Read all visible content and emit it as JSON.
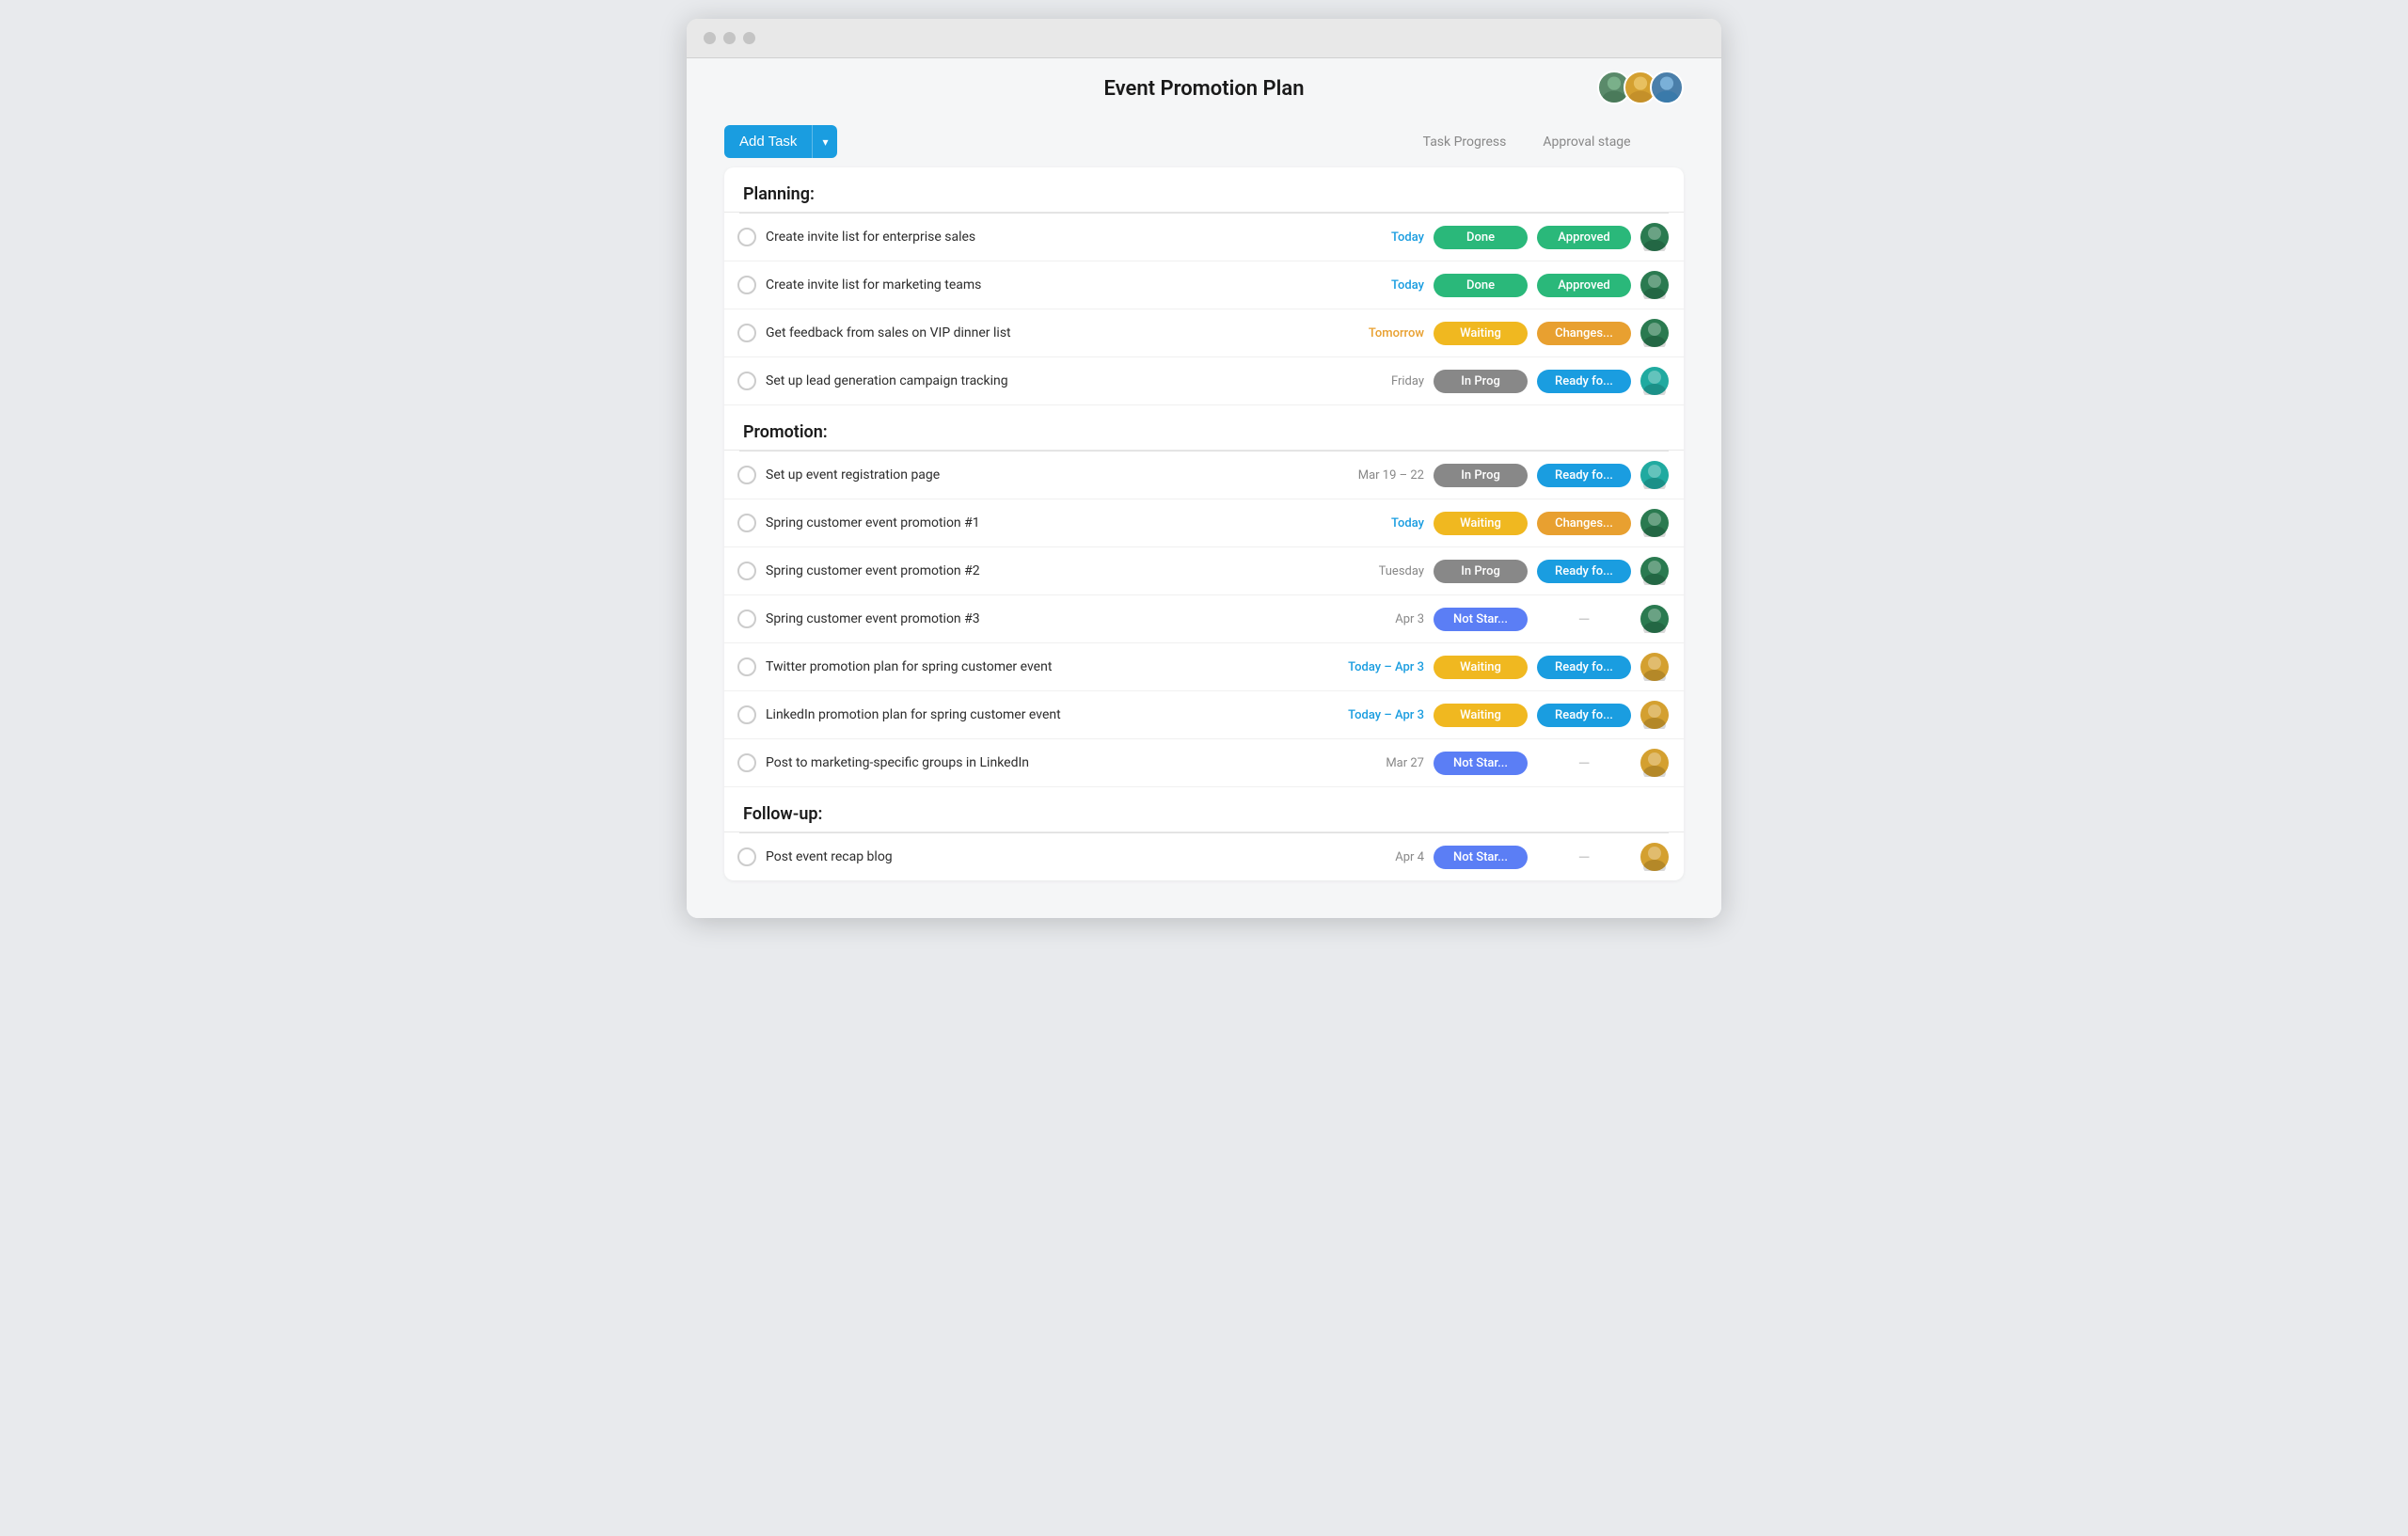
{
  "window": {
    "title": "Event Promotion Plan"
  },
  "header": {
    "title": "Event Promotion Plan",
    "avatars": [
      {
        "id": "av1",
        "class": "avatar-1",
        "label": "U1"
      },
      {
        "id": "av2",
        "class": "avatar-2",
        "label": "U2"
      },
      {
        "id": "av3",
        "class": "avatar-3",
        "label": "U3"
      }
    ]
  },
  "toolbar": {
    "add_task_label": "Add Task",
    "col_headers": [
      "Task Progress",
      "Approval stage"
    ]
  },
  "sections": [
    {
      "id": "planning",
      "title": "Planning:",
      "tasks": [
        {
          "name": "Create invite list for enterprise sales",
          "date": "Today",
          "date_class": "today",
          "progress": "Done",
          "progress_class": "badge-done",
          "approval": "Approved",
          "approval_class": "badge-approved",
          "avatar_class": "av-darkgreen"
        },
        {
          "name": "Create invite list for marketing teams",
          "date": "Today",
          "date_class": "today",
          "progress": "Done",
          "progress_class": "badge-done",
          "approval": "Approved",
          "approval_class": "badge-approved",
          "avatar_class": "av-darkgreen"
        },
        {
          "name": "Get feedback from sales on VIP dinner list",
          "date": "Tomorrow",
          "date_class": "tomorrow",
          "progress": "Waiting",
          "progress_class": "badge-waiting",
          "approval": "Changes...",
          "approval_class": "badge-changes",
          "avatar_class": "av-darkgreen"
        },
        {
          "name": "Set up lead generation campaign tracking",
          "date": "Friday",
          "date_class": "",
          "progress": "In Prog",
          "progress_class": "badge-inprog",
          "approval": "Ready fo...",
          "approval_class": "badge-readyfo",
          "avatar_class": "av-teal"
        }
      ]
    },
    {
      "id": "promotion",
      "title": "Promotion:",
      "tasks": [
        {
          "name": "Set up event registration page",
          "date": "Mar 19 – 22",
          "date_class": "",
          "progress": "In Prog",
          "progress_class": "badge-inprog",
          "approval": "Ready fo...",
          "approval_class": "badge-readyfo",
          "avatar_class": "av-teal"
        },
        {
          "name": "Spring customer event promotion #1",
          "date": "Today",
          "date_class": "today",
          "progress": "Waiting",
          "progress_class": "badge-waiting",
          "approval": "Changes...",
          "approval_class": "badge-changes",
          "avatar_class": "av-darkgreen"
        },
        {
          "name": "Spring customer event promotion #2",
          "date": "Tuesday",
          "date_class": "",
          "progress": "In Prog",
          "progress_class": "badge-inprog",
          "approval": "Ready fo...",
          "approval_class": "badge-readyfo",
          "avatar_class": "av-darkgreen"
        },
        {
          "name": "Spring customer event promotion #3",
          "date": "Apr 3",
          "date_class": "",
          "progress": "Not Star...",
          "progress_class": "badge-notstart",
          "approval": "—",
          "approval_class": "badge-empty",
          "avatar_class": "av-darkgreen"
        },
        {
          "name": "Twitter promotion plan for spring customer event",
          "date": "Today – Apr 3",
          "date_class": "today",
          "progress": "Waiting",
          "progress_class": "badge-waiting",
          "approval": "Ready fo...",
          "approval_class": "badge-readyfo",
          "avatar_class": "av-yellow"
        },
        {
          "name": "LinkedIn promotion plan for spring customer event",
          "date": "Today – Apr 3",
          "date_class": "today",
          "progress": "Waiting",
          "progress_class": "badge-waiting",
          "approval": "Ready fo...",
          "approval_class": "badge-readyfo",
          "avatar_class": "av-yellow"
        },
        {
          "name": "Post to marketing-specific groups in LinkedIn",
          "date": "Mar 27",
          "date_class": "",
          "progress": "Not Star...",
          "progress_class": "badge-notstart",
          "approval": "—",
          "approval_class": "badge-empty",
          "avatar_class": "av-yellow"
        }
      ]
    },
    {
      "id": "followup",
      "title": "Follow-up:",
      "tasks": [
        {
          "name": "Post event recap blog",
          "date": "Apr 4",
          "date_class": "",
          "progress": "Not Star...",
          "progress_class": "badge-notstart",
          "approval": "—",
          "approval_class": "badge-empty",
          "avatar_class": "av-yellow"
        }
      ]
    }
  ]
}
